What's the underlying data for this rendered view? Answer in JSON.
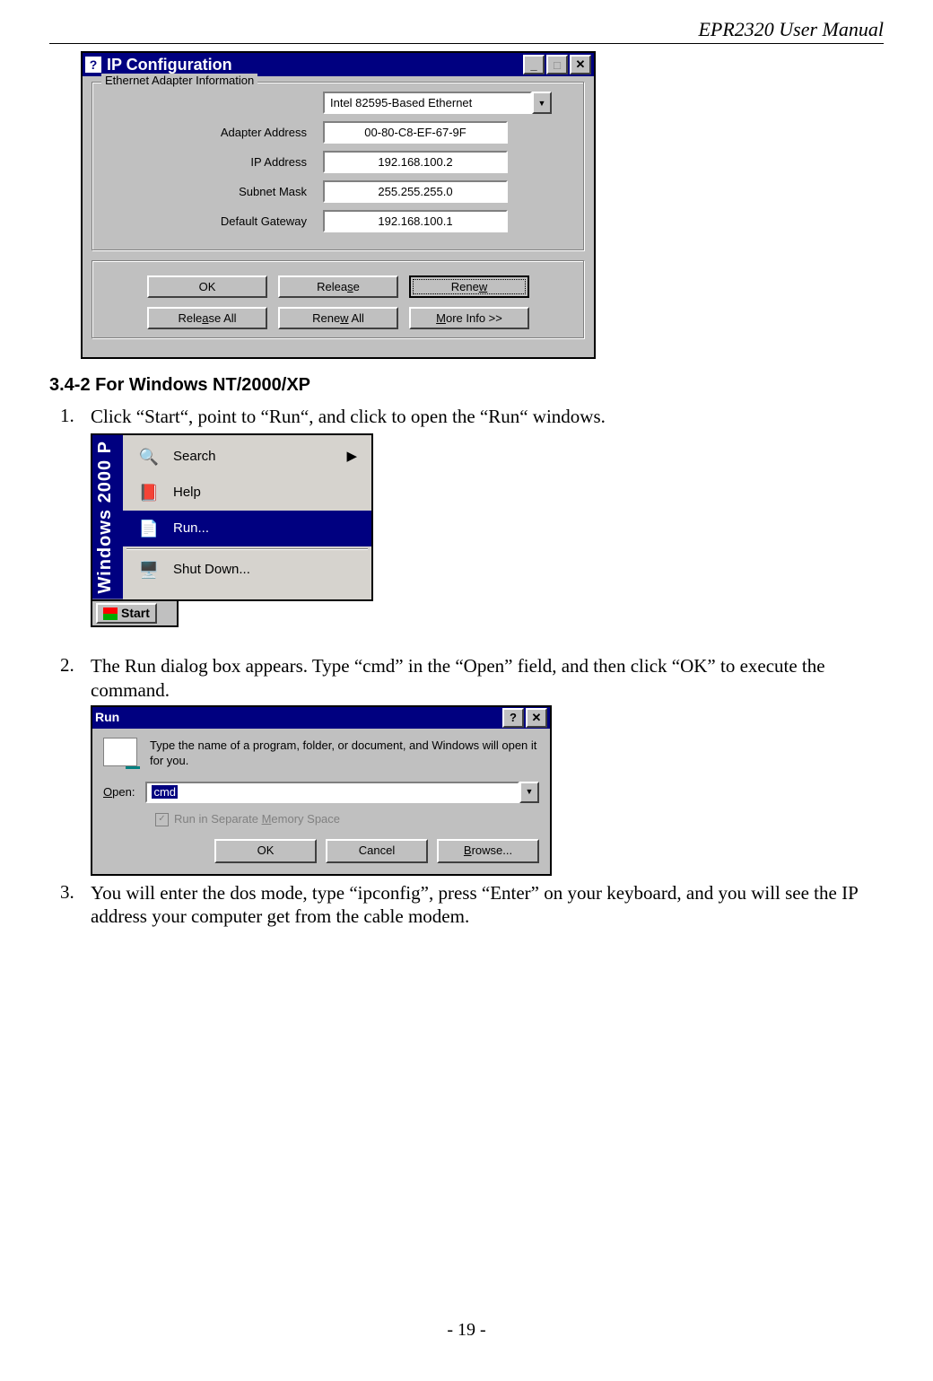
{
  "header": {
    "model": "EPR2320",
    "rest": " User Manual"
  },
  "page_number": "- 19 -",
  "ipconfig": {
    "title": "IP Configuration",
    "group": "Ethernet  Adapter  Information",
    "adapter": "Intel 82595-Based Ethernet",
    "rows": {
      "adapter_address_label": "Adapter Address",
      "adapter_address": "00-80-C8-EF-67-9F",
      "ip_label": "IP Address",
      "ip": "192.168.100.2",
      "subnet_label": "Subnet Mask",
      "subnet": "255.255.255.0",
      "gateway_label": "Default Gateway",
      "gateway": "192.168.100.1"
    },
    "buttons": {
      "ok": "OK",
      "release": "Release",
      "renew": "Renew",
      "release_all": "Release All",
      "renew_all": "Renew All",
      "more": "More Info >>"
    }
  },
  "section_heading": "3.4-2 For Windows NT/2000/XP",
  "steps": {
    "s1": "Click “Start“, point to “Run“, and click to open the “Run“ windows.",
    "s2": "The Run dialog box appears. Type “cmd” in the “Open” field, and then click “OK” to execute the command.",
    "s3": "You will enter the dos mode, type “ipconfig”, press “Enter” on your keyboard, and you will see the IP address your computer get from the cable modem."
  },
  "startmenu": {
    "sidebar": "Windows 2000 P",
    "items": {
      "search": "Search",
      "help": "Help",
      "run": "Run...",
      "shutdown": "Shut Down..."
    },
    "start": "Start"
  },
  "rundlg": {
    "title": "Run",
    "desc": "Type the name of a program, folder, or document, and Windows will open it for you.",
    "open_label": "Open:",
    "open_value": "cmd",
    "checkbox": "Run in Separate Memory Space",
    "buttons": {
      "ok": "OK",
      "cancel": "Cancel",
      "browse": "Browse..."
    }
  }
}
